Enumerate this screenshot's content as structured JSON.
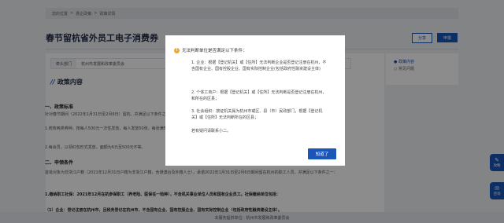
{
  "breadcrumb": [
    "您的位置",
    ">",
    "惠企政策",
    ">",
    "政策详情"
  ],
  "page_title": "春节留杭省外员工电子消费券",
  "share_label": "分享",
  "apply_label": "申报",
  "dept": {
    "label": "牵头部门",
    "value": "杭州市发展和改革委员会"
  },
  "section_title": "政策内容",
  "sub1": "一、政策标准",
  "para1": "针对春节期间（2022年1月31日至2月6日）留杭、并满足以下条件之一的省外员工，发放电子消费券。",
  "para2": "1.统筹两类券种，按每人500元一次性发放，每人发放50张，每张满50元可抵扣10元，可在指定范围内商家使用，可按照程序进行推荐和抽奖活动。",
  "para3": "2.每会员，以领红包形式发放，面额为6元至500元不等。",
  "sub2": "二、申领条件",
  "para4": "首批对象为非浙江户籍（2021年12月31日户籍为非浙江户籍，含港澳台及外籍人士），承诺2022年1月31日至2月6日期间留在杭州的职工人员，并满足以下条件之一：",
  "para5": "1.缴纳职工社保：2021年12月在杭参保职工（养老险、医保任一险种），不含机关事业单位人员和国有企业员工。社保缴纳单位包括：",
  "para6": "（1）企业：登记注册在杭州市，且税务登记在杭州市，不含国有企业、国有控股企业、国有实际控制企业（包括政府性融资建设主体）。",
  "side": {
    "item1": "政策内容",
    "item2": "常见问题"
  },
  "modal": {
    "title": "无法判断单位是否满足以下条件：",
    "p1": "1. 企业：根据【登记机关】或【住所】无法判断企业是否登记注册在杭州，不含国有企业、国有控股企业、国有实际控制企业(包括政府性融资建设主体)",
    "p2": "2. 个体工商户：根据【登记机关】或【住所】无法判断是否登记注册在杭州，和所在的区县；",
    "p3": "3. 社会组织：按证机关属为杭州市或区、县（市）民政部门，根据【登记机关】或【住所】无法判断所在的区县；",
    "p4": "若有疑问请联系小二。",
    "button": "知道了"
  },
  "footer": "本服务提供单位：杭州市发展和改革委员会",
  "float1": "攻略",
  "float2": "咨询"
}
